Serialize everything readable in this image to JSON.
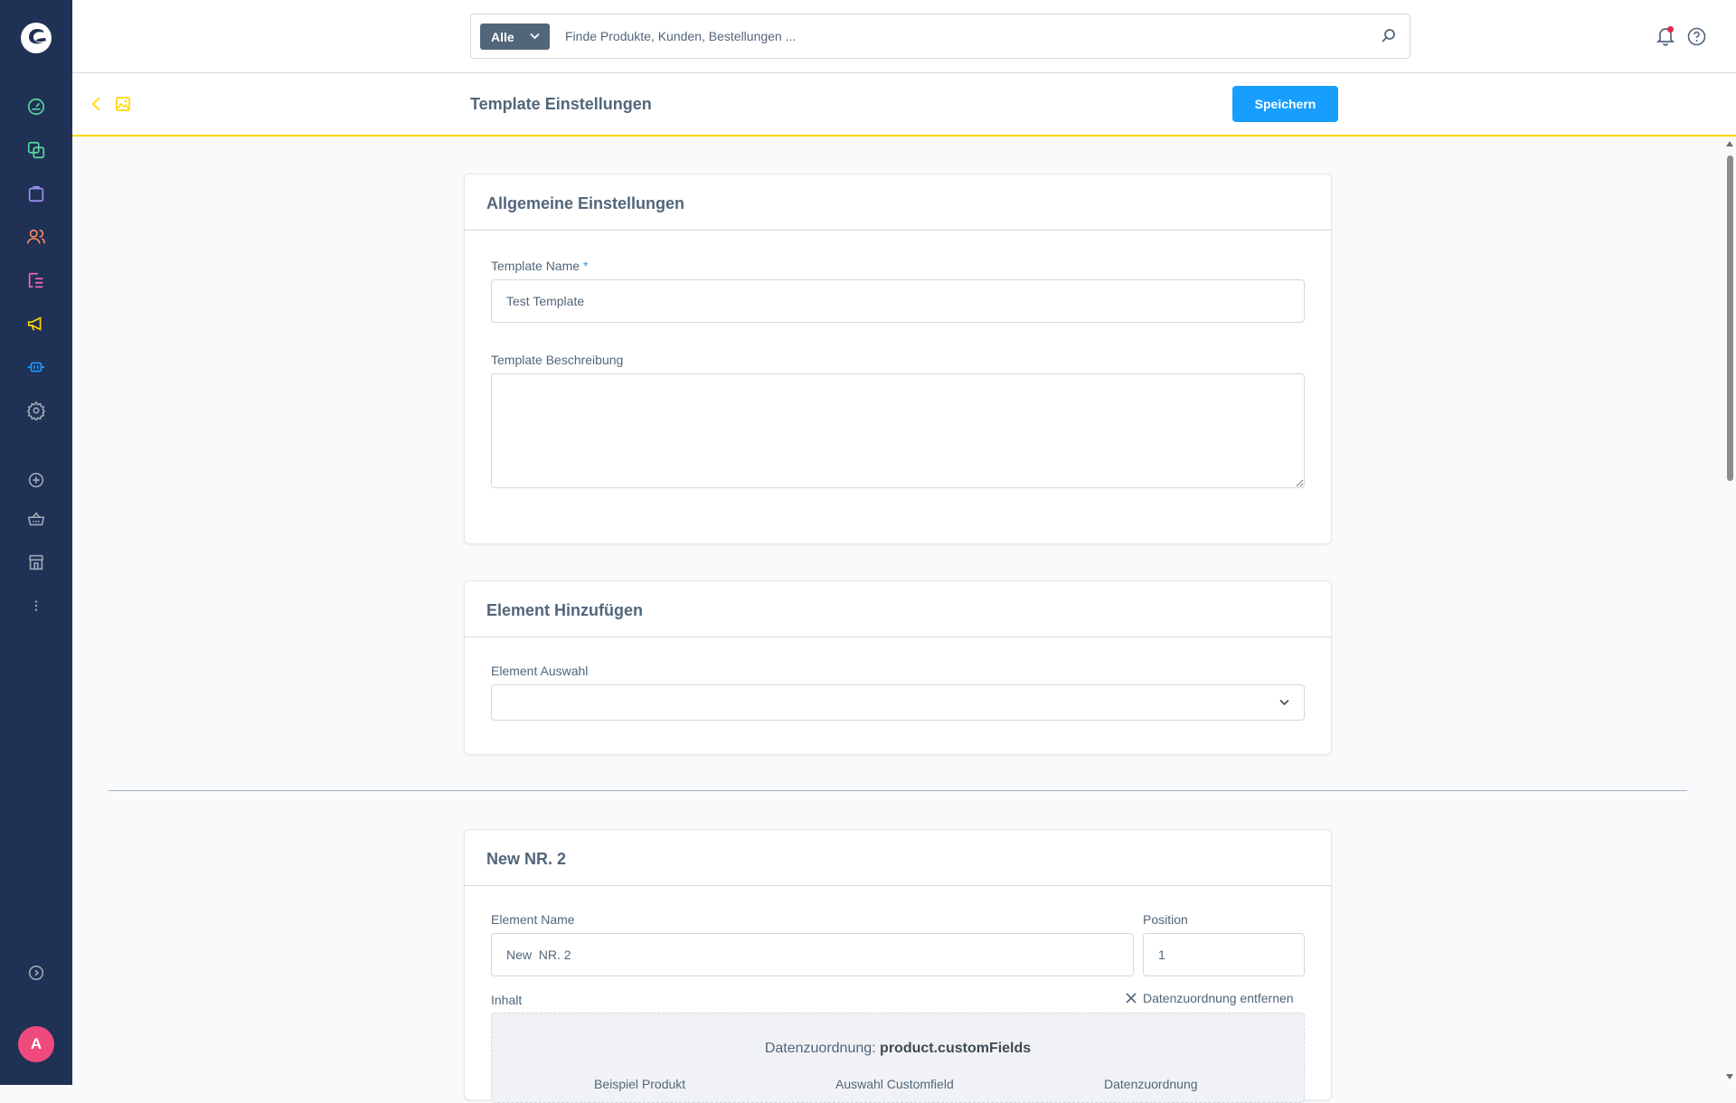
{
  "app": {
    "avatar_initial": "A"
  },
  "search": {
    "type_label": "Alle",
    "placeholder": "Finde Produkte, Kunden, Bestellungen ..."
  },
  "smartbar": {
    "title": "Template Einstellungen",
    "save_label": "Speichern"
  },
  "sidebar": {
    "items": [
      {
        "icon": "dashboard-icon",
        "color": "#57d9a3"
      },
      {
        "icon": "catalogue-icon",
        "color": "#57d9a3"
      },
      {
        "icon": "orders-icon",
        "color": "#a092f0"
      },
      {
        "icon": "customers-icon",
        "color": "#f88962"
      },
      {
        "icon": "content-icon",
        "color": "#ff68b4"
      },
      {
        "icon": "marketing-icon",
        "color": "#ffd700"
      },
      {
        "icon": "extensions-icon",
        "color": "#189eff"
      },
      {
        "icon": "settings-icon",
        "color": "#9aa8b5"
      },
      {
        "icon": "add-icon",
        "color": "#9aa8b5"
      },
      {
        "icon": "basket-icon",
        "color": "#9aa8b5"
      },
      {
        "icon": "storefront-icon",
        "color": "#9aa8b5"
      },
      {
        "icon": "more-icon",
        "color": "#9aa8b5"
      },
      {
        "icon": "collapse-icon",
        "color": "#9aa8b5"
      }
    ]
  },
  "general_card": {
    "title": "Allgemeine Einstellungen",
    "name_label": "Template Name",
    "name_required": "*",
    "name_value": "Test Template",
    "description_label": "Template Beschreibung",
    "description_value": ""
  },
  "add_element_card": {
    "title": "Element Hinzufügen",
    "select_label": "Element Auswahl",
    "select_value": ""
  },
  "element_card": {
    "title": "New NR. 2",
    "name_label": "Element Name",
    "name_value": "New  NR. 2",
    "position_label": "Position",
    "position_value": "1",
    "content_label": "Inhalt",
    "remove_mapping_label": "Datenzuordnung entfernen",
    "mapping_prefix": "Datenzuordnung:",
    "mapping_value": "product.customFields",
    "mapping_columns": [
      "Beispiel Produkt",
      "Auswahl Customfield",
      "Datenzuordnung"
    ]
  },
  "colors": {
    "sidebar_bg": "#1f3154",
    "accent": "#189eff",
    "smartbar_border": "#ffd700",
    "avatar": "#ee4b7c"
  }
}
